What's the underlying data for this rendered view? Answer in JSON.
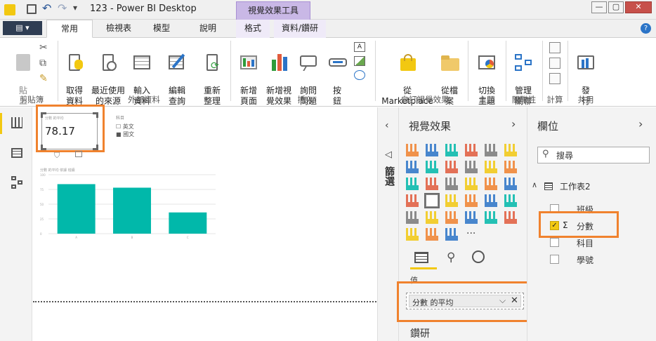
{
  "window": {
    "title": "123 - Power BI Desktop",
    "context_tab": "視覺效果工具",
    "controls": {
      "minimize": "—",
      "restore": "▢",
      "close": "✕"
    }
  },
  "tabs": {
    "file": "▤ ▾",
    "items": [
      "常用",
      "檢視表",
      "模型",
      "說明",
      "格式",
      "資料/鑽研"
    ]
  },
  "ribbon": {
    "clipboard": {
      "paste": "貼\n上",
      "group": "剪貼簿"
    },
    "external": {
      "get_data": "取得\n資料",
      "recent": "最近使用\n的來源",
      "enter": "輸入\n資料",
      "edit": "編輯\n查詢",
      "refresh": "重新\n整理",
      "group": "外部資料"
    },
    "insert": {
      "new_page": "新增\n頁面",
      "new_visual": "新增視\n覺效果",
      "ask": "詢問\n問題",
      "button": "按\n鈕",
      "group": "插入"
    },
    "custom": {
      "marketplace": "從\nMarketplace",
      "file": "從檔\n案",
      "group": "自訂視覺效果"
    },
    "theme": {
      "switch": "切換\n主題",
      "group": "主題"
    },
    "relations": {
      "manage": "管理\n關聯",
      "group": "關聯性"
    },
    "calc": {
      "group": "計算"
    },
    "share": {
      "publish": "發\n行",
      "group": "共用"
    }
  },
  "canvas": {
    "card": {
      "value": "78.17",
      "label": "分數 的平均"
    },
    "slicer": {
      "title": "科目",
      "items": [
        "英文",
        "國文"
      ]
    },
    "chart": {
      "title": "分數 的平均 依據 班級"
    }
  },
  "chart_data": {
    "type": "bar",
    "title": "分數 的平均 依據 班級",
    "categories": [
      "A",
      "B",
      "C"
    ],
    "values": [
      84,
      78,
      36
    ],
    "ylim": [
      0,
      100
    ],
    "color": "#01b8aa"
  },
  "filters_label": "篩選",
  "viz_pane": {
    "title": "視覺效果",
    "values_label": "值",
    "field_well_item": "分數 的平均",
    "drill_label": "鑽研"
  },
  "fields_pane": {
    "title": "欄位",
    "search_placeholder": "搜尋",
    "table": "工作表2",
    "fields": [
      {
        "name": "班級",
        "checked": false,
        "sigma": false
      },
      {
        "name": "分數",
        "checked": true,
        "sigma": true
      },
      {
        "name": "科目",
        "checked": false,
        "sigma": false
      },
      {
        "name": "學號",
        "checked": false,
        "sigma": false
      }
    ]
  },
  "colors": {
    "accent": "#f0822e",
    "teal": "#01b8aa",
    "check": "#f2c811"
  }
}
